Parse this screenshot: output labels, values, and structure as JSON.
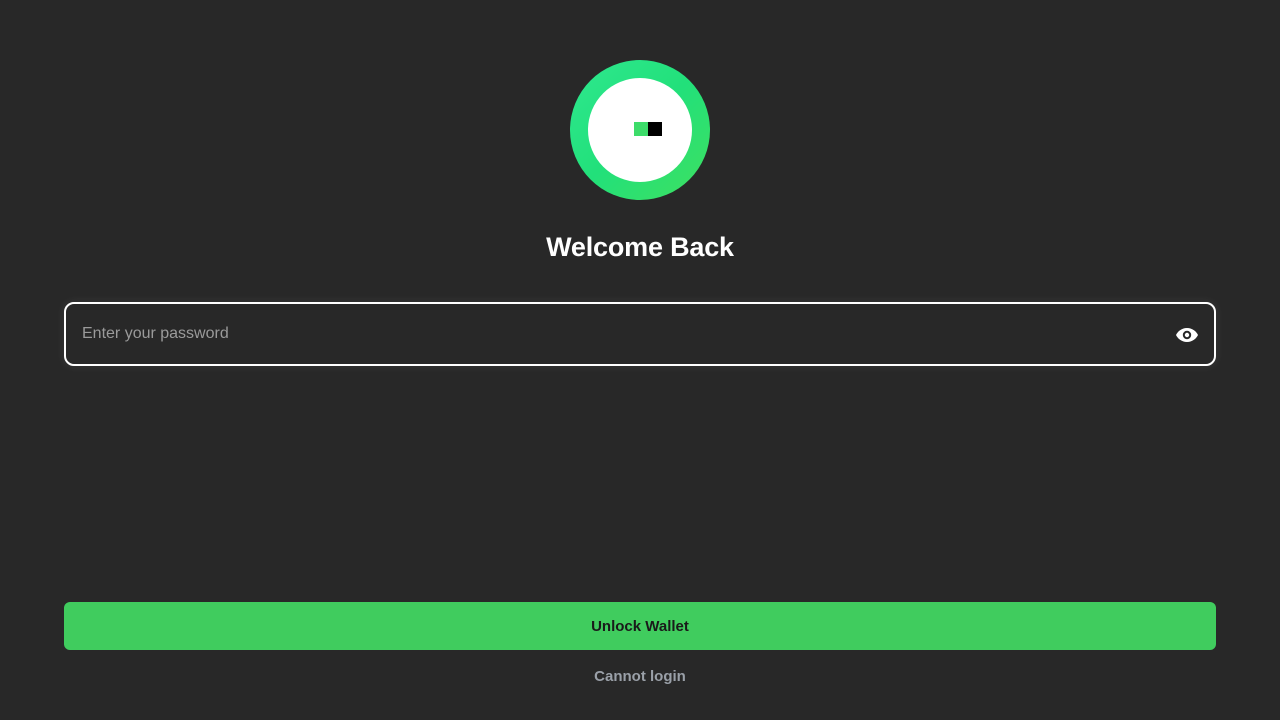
{
  "header": {
    "title": "Welcome Back"
  },
  "password": {
    "placeholder": "Enter your password",
    "value": "",
    "toggle_icon": "eye-icon"
  },
  "actions": {
    "unlock_label": "Unlock Wallet",
    "cannot_login_label": "Cannot login"
  },
  "colors": {
    "background": "#282828",
    "accent": "#40cc5e",
    "logo_ring": "#22e07a"
  }
}
